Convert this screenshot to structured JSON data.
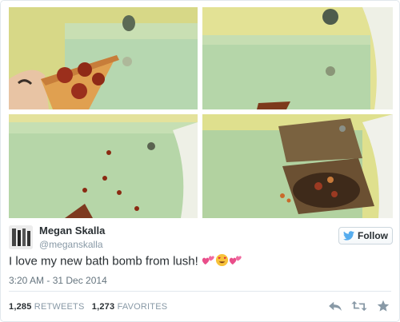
{
  "tweet": {
    "author_name": "Megan Skalla",
    "author_handle": "@meganskalla",
    "follow_label": "Follow",
    "text": "I love my new bath bomb from lush!",
    "emojis": [
      "two-hearts",
      "heart-eyes-face",
      "two-hearts"
    ],
    "timestamp": "3:20 AM - 31 Dec 2014",
    "retweets_count": "1,285",
    "retweets_label": "RETWEETS",
    "favorites_count": "1,273",
    "favorites_label": "FAVORITES"
  },
  "photos": [
    {
      "name": "pizza-slice-held-over-bath"
    },
    {
      "name": "pizza-slice-in-bath-water"
    },
    {
      "name": "pepperoni-floating-in-bath"
    },
    {
      "name": "pizza-box-in-bath"
    }
  ],
  "icons": {
    "follow": "twitter-bird-icon",
    "reply": "reply-icon",
    "retweet": "retweet-icon",
    "favorite": "star-icon"
  },
  "colors": {
    "brand_blue": "#55acee",
    "bath_water": "#b9d6a8",
    "bath_tile": "#e8e59a",
    "pepperoni": "#8a2a12",
    "text_primary": "#292f33",
    "text_muted": "#8899a6"
  }
}
